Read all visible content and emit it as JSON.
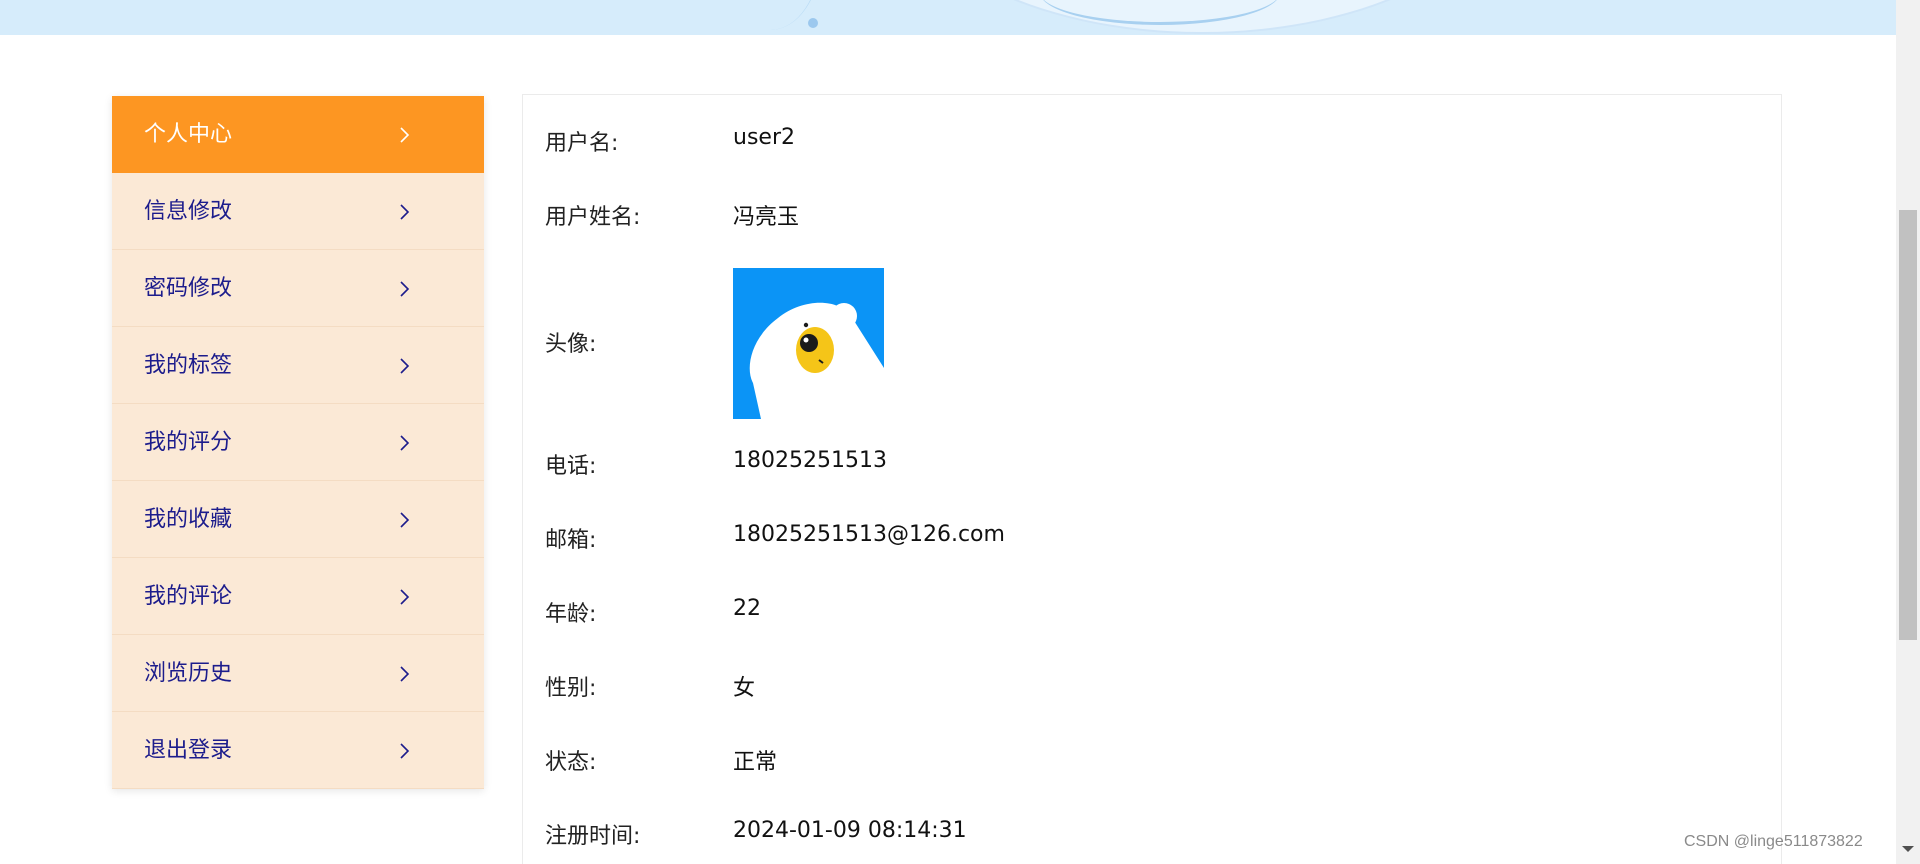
{
  "sidebar": {
    "items": [
      {
        "label": "个人中心",
        "active": true
      },
      {
        "label": "信息修改",
        "active": false
      },
      {
        "label": "密码修改",
        "active": false
      },
      {
        "label": "我的标签",
        "active": false
      },
      {
        "label": "我的评分",
        "active": false
      },
      {
        "label": "我的收藏",
        "active": false
      },
      {
        "label": "我的评论",
        "active": false
      },
      {
        "label": "浏览历史",
        "active": false
      },
      {
        "label": "退出登录",
        "active": false
      }
    ],
    "active_color": "#fd9622",
    "item_bg": "#fbe9d6",
    "text_color": "#1c1c8c",
    "item_icon": "chevron-right-icon"
  },
  "profile": {
    "username": {
      "label": "用户名:",
      "value": "user2"
    },
    "realname": {
      "label": "用户姓名:",
      "value": "冯亮玉"
    },
    "avatar": {
      "label": "头像:",
      "icon": "bear-avatar-icon",
      "bg_color": "#0b94f6"
    },
    "phone": {
      "label": "电话:",
      "value": "18025251513"
    },
    "email": {
      "label": "邮箱:",
      "value": "18025251513@126.com"
    },
    "age": {
      "label": "年龄:",
      "value": "22"
    },
    "gender": {
      "label": "性别:",
      "value": "女"
    },
    "status": {
      "label": "状态:",
      "value": "正常"
    },
    "register_time": {
      "label": "注册时间:",
      "value": "2024-01-09 08:14:31"
    }
  },
  "watermark": "CSDN @linge511873822"
}
